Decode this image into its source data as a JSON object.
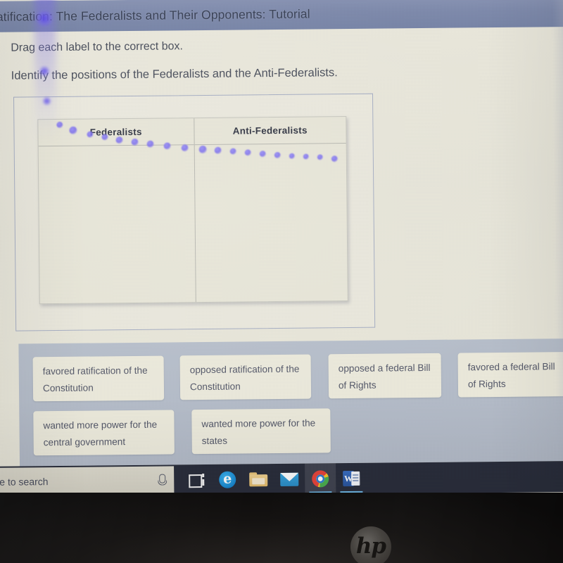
{
  "header": {
    "title": "atification: The Federalists and Their Opponents: Tutorial",
    "bar_color": "#808cae"
  },
  "instructions": {
    "line1": "Drag each label to the correct box.",
    "line2": "Identify the positions of the Federalists and the Anti-Federalists."
  },
  "table": {
    "columns": [
      {
        "header": "Federalists",
        "items": []
      },
      {
        "header": "Anti-Federalists",
        "items": []
      }
    ]
  },
  "labels": [
    {
      "id": "label-1",
      "text_line1": "favored ratification of the",
      "text_line2": "Constitution"
    },
    {
      "id": "label-2",
      "text_line1": "opposed ratification of the",
      "text_line2": "Constitution"
    },
    {
      "id": "label-3",
      "text_line1": "opposed a federal Bill",
      "text_line2": "of Rights"
    },
    {
      "id": "label-4",
      "text_line1": "favored a federal Bill",
      "text_line2": "of Rights"
    },
    {
      "id": "label-5",
      "text_line1": "wanted more power for the",
      "text_line2": "central government"
    },
    {
      "id": "label-6",
      "text_line1": "wanted more power for the",
      "text_line2": "states"
    }
  ],
  "taskbar": {
    "search_text": "e to search",
    "mic_icon": "microphone-icon",
    "items": [
      {
        "name": "task-view",
        "icon": "task-view-icon",
        "label": "Task View",
        "active": false,
        "running": false
      },
      {
        "name": "edge",
        "icon": "edge-icon",
        "label": "e",
        "active": false,
        "running": false
      },
      {
        "name": "file-explorer",
        "icon": "folder-icon",
        "label": "File Explorer",
        "active": false,
        "running": false
      },
      {
        "name": "mail",
        "icon": "mail-icon",
        "label": "Mail",
        "active": false,
        "running": false
      },
      {
        "name": "chrome",
        "icon": "chrome-icon",
        "label": "Google Chrome",
        "active": true,
        "running": true
      },
      {
        "name": "word",
        "icon": "word-icon",
        "label": "W",
        "active": false,
        "running": true
      }
    ]
  },
  "device": {
    "brand": "hp"
  }
}
